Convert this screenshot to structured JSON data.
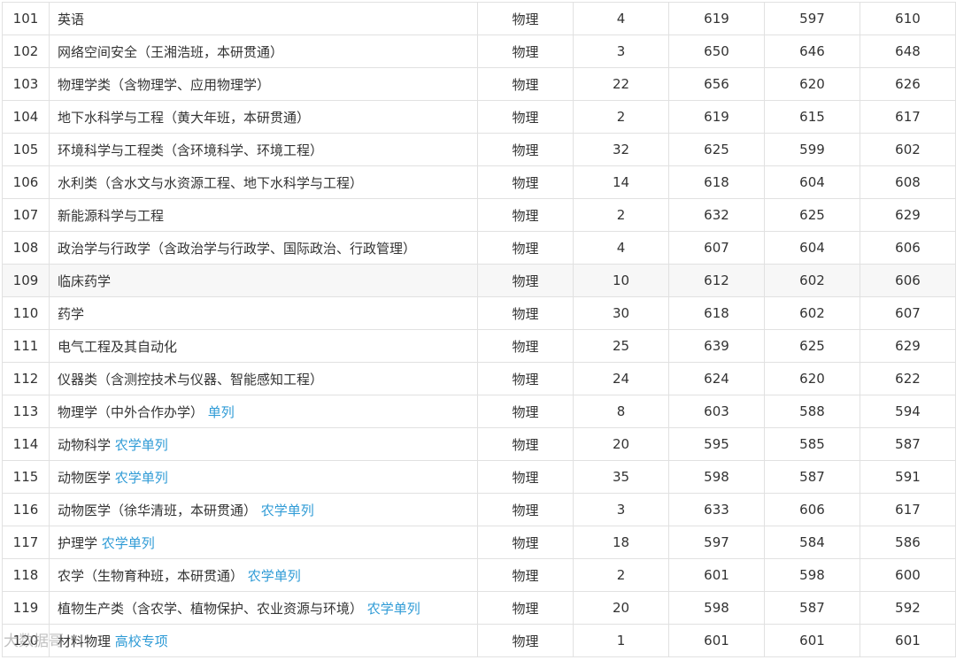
{
  "table": {
    "rows": [
      {
        "no": "101",
        "major": "英语",
        "tag": "",
        "subject": "物理",
        "plan": "4",
        "max": "619",
        "min": "597",
        "avg": "610"
      },
      {
        "no": "102",
        "major": "网络空间安全（王湘浩班，本研贯通）",
        "tag": "",
        "subject": "物理",
        "plan": "3",
        "max": "650",
        "min": "646",
        "avg": "648"
      },
      {
        "no": "103",
        "major": "物理学类（含物理学、应用物理学）",
        "tag": "",
        "subject": "物理",
        "plan": "22",
        "max": "656",
        "min": "620",
        "avg": "626"
      },
      {
        "no": "104",
        "major": "地下水科学与工程（黄大年班，本研贯通）",
        "tag": "",
        "subject": "物理",
        "plan": "2",
        "max": "619",
        "min": "615",
        "avg": "617"
      },
      {
        "no": "105",
        "major": "环境科学与工程类（含环境科学、环境工程）",
        "tag": "",
        "subject": "物理",
        "plan": "32",
        "max": "625",
        "min": "599",
        "avg": "602"
      },
      {
        "no": "106",
        "major": "水利类（含水文与水资源工程、地下水科学与工程）",
        "tag": "",
        "subject": "物理",
        "plan": "14",
        "max": "618",
        "min": "604",
        "avg": "608"
      },
      {
        "no": "107",
        "major": "新能源科学与工程",
        "tag": "",
        "subject": "物理",
        "plan": "2",
        "max": "632",
        "min": "625",
        "avg": "629"
      },
      {
        "no": "108",
        "major": "政治学与行政学（含政治学与行政学、国际政治、行政管理）",
        "tag": "",
        "subject": "物理",
        "plan": "4",
        "max": "607",
        "min": "604",
        "avg": "606"
      },
      {
        "no": "109",
        "major": "临床药学",
        "tag": "",
        "subject": "物理",
        "plan": "10",
        "max": "612",
        "min": "602",
        "avg": "606",
        "highlight": true
      },
      {
        "no": "110",
        "major": "药学",
        "tag": "",
        "subject": "物理",
        "plan": "30",
        "max": "618",
        "min": "602",
        "avg": "607"
      },
      {
        "no": "111",
        "major": "电气工程及其自动化",
        "tag": "",
        "subject": "物理",
        "plan": "25",
        "max": "639",
        "min": "625",
        "avg": "629"
      },
      {
        "no": "112",
        "major": "仪器类（含测控技术与仪器、智能感知工程）",
        "tag": "",
        "subject": "物理",
        "plan": "24",
        "max": "624",
        "min": "620",
        "avg": "622"
      },
      {
        "no": "113",
        "major": "物理学（中外合作办学） ",
        "tag": "单列",
        "subject": "物理",
        "plan": "8",
        "max": "603",
        "min": "588",
        "avg": "594"
      },
      {
        "no": "114",
        "major": "动物科学 ",
        "tag": "农学单列",
        "subject": "物理",
        "plan": "20",
        "max": "595",
        "min": "585",
        "avg": "587"
      },
      {
        "no": "115",
        "major": "动物医学 ",
        "tag": "农学单列",
        "subject": "物理",
        "plan": "35",
        "max": "598",
        "min": "587",
        "avg": "591"
      },
      {
        "no": "116",
        "major": "动物医学（徐华清班，本研贯通） ",
        "tag": "农学单列",
        "subject": "物理",
        "plan": "3",
        "max": "633",
        "min": "606",
        "avg": "617"
      },
      {
        "no": "117",
        "major": "护理学 ",
        "tag": "农学单列",
        "subject": "物理",
        "plan": "18",
        "max": "597",
        "min": "584",
        "avg": "586"
      },
      {
        "no": "118",
        "major": "农学（生物育种班，本研贯通） ",
        "tag": "农学单列",
        "subject": "物理",
        "plan": "2",
        "max": "601",
        "min": "598",
        "avg": "600"
      },
      {
        "no": "119",
        "major": "植物生产类（含农学、植物保护、农业资源与环境） ",
        "tag": "农学单列",
        "subject": "物理",
        "plan": "20",
        "max": "598",
        "min": "587",
        "avg": "592"
      },
      {
        "no": "120",
        "major": "材料物理 ",
        "tag": "高校专项",
        "subject": "物理",
        "plan": "1",
        "max": "601",
        "min": "601",
        "avg": "601"
      }
    ]
  },
  "watermark": "大数据哥"
}
